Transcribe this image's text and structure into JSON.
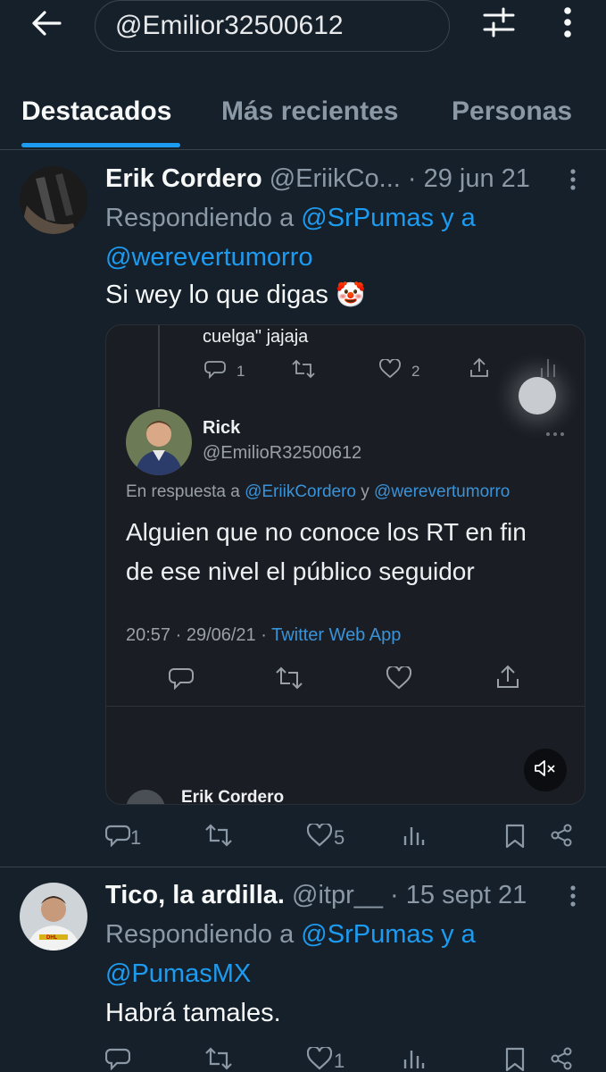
{
  "header": {
    "search_value": "@Emilior32500612"
  },
  "tabs": [
    {
      "label": "Destacados",
      "active": true
    },
    {
      "label": "Más recientes",
      "active": false
    },
    {
      "label": "Personas",
      "active": false
    }
  ],
  "tweets": [
    {
      "name": "Erik Cordero",
      "handle": "@EriikCo...",
      "separator": "·",
      "date": "29 jun 21",
      "reply_prefix": "Respondiendo a",
      "reply_mention_1": "@SrPumas",
      "reply_and": "y a",
      "reply_mention_2": "@werevertumorro",
      "text": "Si wey lo que digas",
      "emoji": "🤡",
      "replies": "1",
      "retweets": "",
      "likes": "5",
      "media": {
        "quoted_top_text": "cuelga\" jajaja",
        "quoted_top_replies": "1",
        "quoted_top_likes": "2",
        "author_name": "Rick",
        "author_handle": "@EmilioR32500612",
        "reply_prefix": "En respuesta a",
        "reply_mention_1": "@EriikCordero",
        "reply_and": "y",
        "reply_mention_2": "@werevertumorro",
        "body_line_1": "Alguien que no conoce los RT en fin",
        "body_line_2": "de ese nivel el público seguidor",
        "meta_time": "20:57 · 29/06/21 ·",
        "meta_app": "Twitter Web App",
        "next_author": "Erik Cordero"
      }
    },
    {
      "name": "Tico, la ardilla.",
      "handle": "@itpr__",
      "separator": "·",
      "date": "15 sept 21",
      "reply_prefix": "Respondiendo a",
      "reply_mention_1": "@SrPumas",
      "reply_and": "y a",
      "reply_mention_2": "@PumasMX",
      "text": "Habrá tamales.",
      "replies": "",
      "retweets": "",
      "likes": "1"
    }
  ],
  "colors": {
    "background": "#15202b",
    "accent": "#1d9bf0",
    "secondary_text": "#8b98a5",
    "border": "#38444d"
  }
}
